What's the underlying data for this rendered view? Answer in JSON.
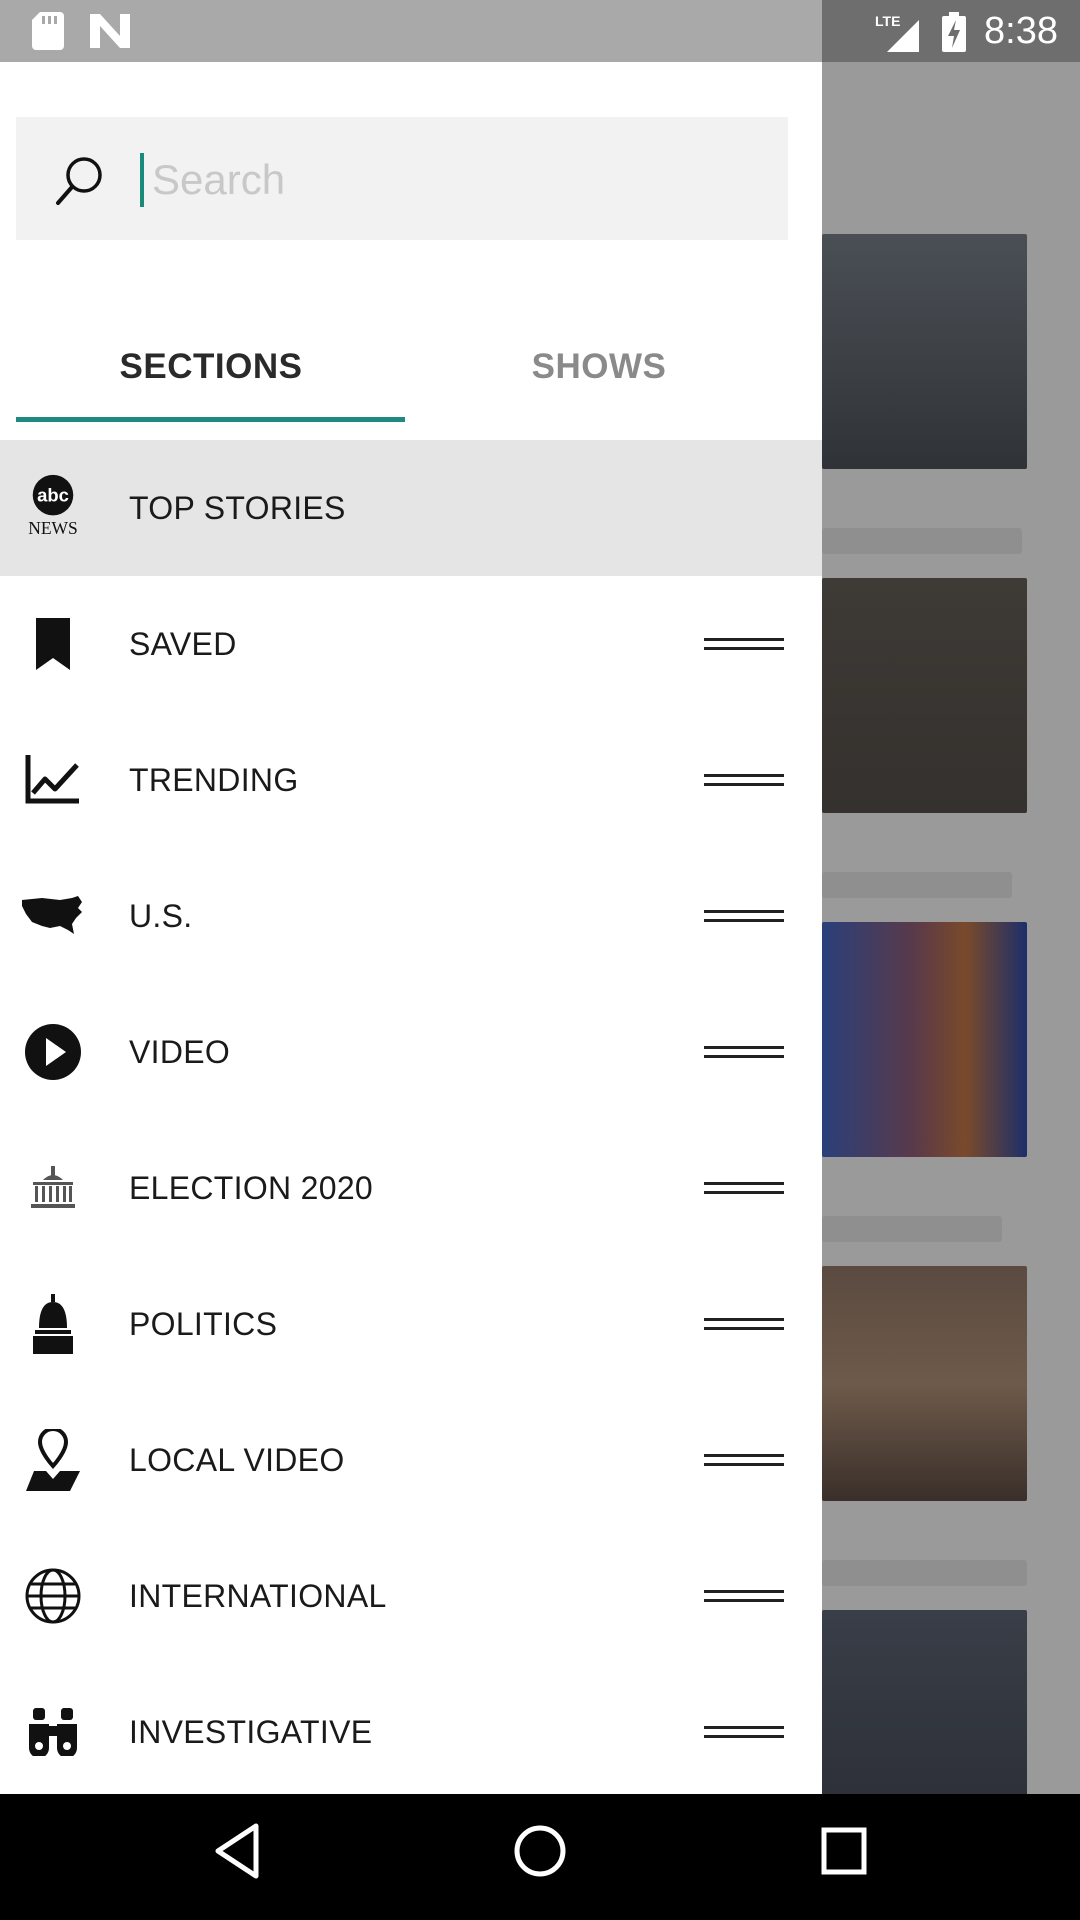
{
  "status_bar": {
    "time": "8:38",
    "network": "LTE",
    "icons": [
      "sd-card-icon",
      "n-notification-icon",
      "signal-icon",
      "battery-charging-icon"
    ]
  },
  "search": {
    "placeholder": "Search",
    "value": ""
  },
  "tabs": [
    {
      "label": "SECTIONS",
      "selected": true
    },
    {
      "label": "SHOWS",
      "selected": false
    }
  ],
  "sections": [
    {
      "label": "TOP STORIES",
      "icon": "abc-news-logo-icon",
      "active": true
    },
    {
      "label": "SAVED",
      "icon": "bookmark-icon"
    },
    {
      "label": "TRENDING",
      "icon": "trending-chart-icon"
    },
    {
      "label": "U.S.",
      "icon": "us-map-icon"
    },
    {
      "label": "VIDEO",
      "icon": "play-icon"
    },
    {
      "label": "ELECTION 2020",
      "icon": "capitol-building-icon"
    },
    {
      "label": "POLITICS",
      "icon": "capitol-dome-icon"
    },
    {
      "label": "LOCAL VIDEO",
      "icon": "location-pin-icon"
    },
    {
      "label": "INTERNATIONAL",
      "icon": "globe-icon"
    },
    {
      "label": "INVESTIGATIVE",
      "icon": "binoculars-icon"
    }
  ],
  "abc_logo": {
    "line1": "abc",
    "line2": "NEWS"
  },
  "colors": {
    "accent": "#1f8a80",
    "active_row": "#e5e5e5",
    "scrim": "#9a9a9a"
  }
}
